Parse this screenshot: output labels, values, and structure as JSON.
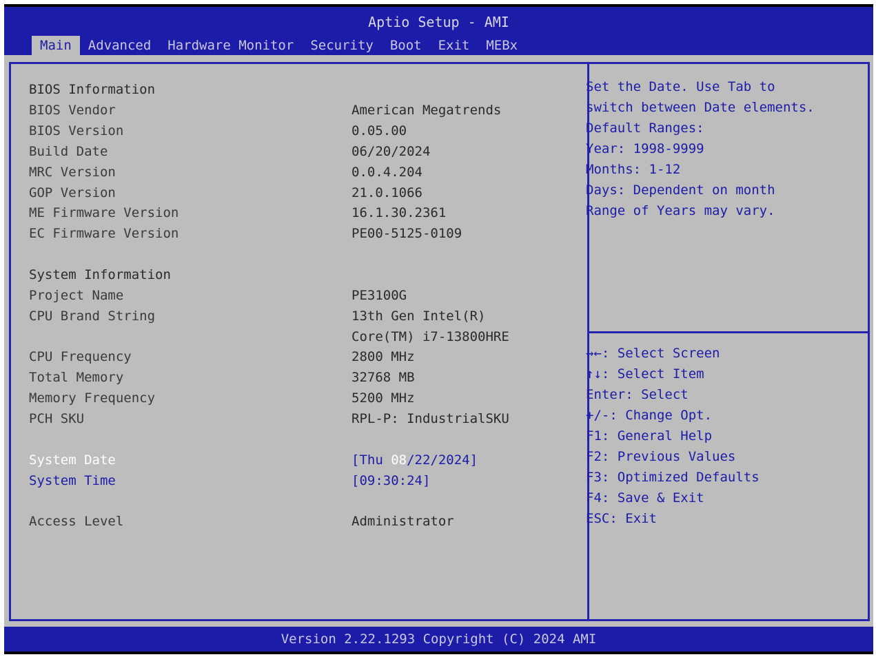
{
  "app": {
    "title": "Aptio Setup - AMI"
  },
  "tabs": [
    {
      "label": "Main",
      "active": true
    },
    {
      "label": "Advanced",
      "active": false
    },
    {
      "label": "Hardware Monitor",
      "active": false
    },
    {
      "label": "Security",
      "active": false
    },
    {
      "label": "Boot",
      "active": false
    },
    {
      "label": "Exit",
      "active": false
    },
    {
      "label": "MEBx",
      "active": false
    }
  ],
  "main": {
    "bios_heading": "BIOS Information",
    "bios_vendor_label": "BIOS Vendor",
    "bios_vendor": "American Megatrends",
    "bios_version_label": "BIOS Version",
    "bios_version": "0.05.00",
    "build_date_label": "Build Date",
    "build_date": "06/20/2024",
    "mrc_version_label": "MRC Version",
    "mrc_version": "0.0.4.204",
    "gop_version_label": "GOP Version",
    "gop_version": "21.0.1066",
    "me_fw_label": "ME Firmware Version",
    "me_fw": "16.1.30.2361",
    "ec_fw_label": "EC Firmware Version",
    "ec_fw": "PE00-5125-0109",
    "system_heading": "System Information",
    "project_name_label": "Project Name",
    "project_name": "PE3100G",
    "cpu_brand_label": "CPU Brand String",
    "cpu_brand_line1": "13th Gen Intel(R)",
    "cpu_brand_line2": "Core(TM) i7-13800HRE",
    "cpu_freq_label": "CPU Frequency",
    "cpu_freq": "2800 MHz",
    "total_mem_label": "Total Memory",
    "total_mem": "32768 MB",
    "mem_freq_label": "Memory Frequency",
    "mem_freq": "5200 MHz",
    "pch_sku_label": "PCH SKU",
    "pch_sku": "RPL-P: IndustrialSKU",
    "system_date_label": "System Date",
    "system_date_prefix": "[Thu ",
    "system_date_month": "08",
    "system_date_suffix": "/22/2024]",
    "system_time_label": "System Time",
    "system_time": "[09:30:24]",
    "access_level_label": "Access Level",
    "access_level": "Administrator"
  },
  "help": {
    "lines": [
      "Set the Date. Use Tab to",
      "switch between Date elements.",
      "Default Ranges:",
      "Year: 1998-9999",
      "Months: 1-12",
      "Days: Dependent on month",
      "Range of Years may vary."
    ]
  },
  "keys": [
    {
      "key": "→←",
      "desc": ": Select Screen"
    },
    {
      "key": "↑↓",
      "desc": ": Select Item"
    },
    {
      "key": "Enter",
      "desc": ": Select"
    },
    {
      "key": "+/-",
      "desc": ": Change Opt."
    },
    {
      "key": "F1",
      "desc": ": General Help"
    },
    {
      "key": "F2",
      "desc": ": Previous Values"
    },
    {
      "key": "F3",
      "desc": ": Optimized Defaults"
    },
    {
      "key": "F4",
      "desc": ": Save & Exit"
    },
    {
      "key": "ESC",
      "desc": ": Exit"
    }
  ],
  "footer": {
    "text": "Version 2.22.1293 Copyright (C) 2024 AMI"
  },
  "colors": {
    "accent": "#1c1ca8",
    "panel": "#bdbdbd",
    "text": "#2a2a2a",
    "selected": "#ffffff"
  }
}
